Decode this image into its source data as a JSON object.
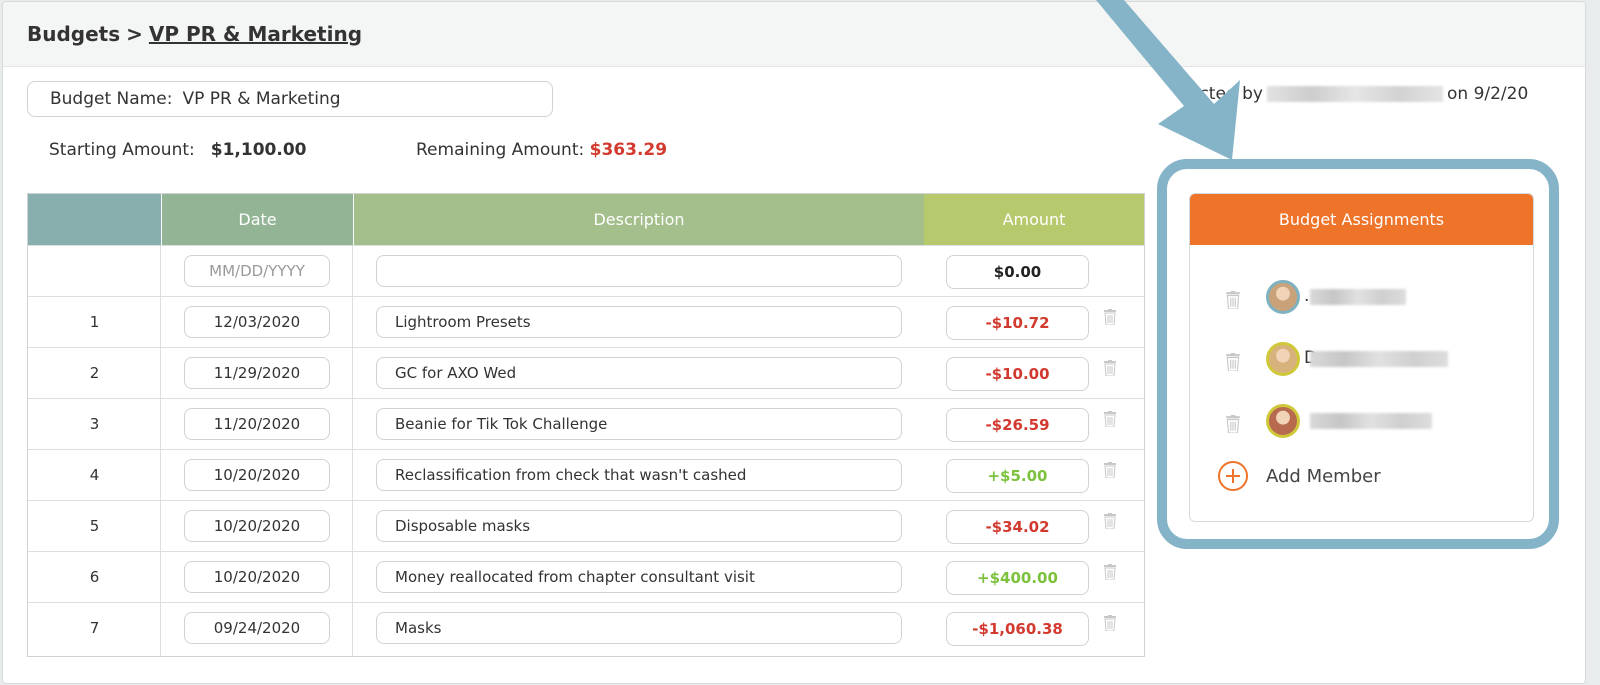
{
  "breadcrumb": {
    "root": "Budgets",
    "separator": ">",
    "current": "VP PR & Marketing"
  },
  "budget": {
    "name_label": "Budget Name:",
    "name_value": "VP PR & Marketing",
    "starting_label": "Starting Amount:",
    "starting_value": "$1,100.00",
    "remaining_label": "Remaining Amount:",
    "remaining_value": "$363.29",
    "created_prefix": "ected by",
    "created_suffix": "on 9/2/20"
  },
  "table": {
    "headers": [
      "",
      "Date",
      "Description",
      "Amount"
    ],
    "new_row": {
      "date_placeholder": "MM/DD/YYYY",
      "description": "",
      "amount": "$0.00"
    },
    "rows": [
      {
        "num": "1",
        "date": "12/03/2020",
        "description": "Lightroom Presets",
        "amount": "-$10.72",
        "sign": "neg"
      },
      {
        "num": "2",
        "date": "11/29/2020",
        "description": "GC for AXO Wed",
        "amount": "-$10.00",
        "sign": "neg"
      },
      {
        "num": "3",
        "date": "11/20/2020",
        "description": "Beanie for Tik Tok Challenge",
        "amount": "-$26.59",
        "sign": "neg"
      },
      {
        "num": "4",
        "date": "10/20/2020",
        "description": "Reclassification from check that wasn't cashed",
        "amount": "+$5.00",
        "sign": "pos"
      },
      {
        "num": "5",
        "date": "10/20/2020",
        "description": "Disposable masks",
        "amount": "-$34.02",
        "sign": "neg"
      },
      {
        "num": "6",
        "date": "10/20/2020",
        "description": "Money reallocated from chapter consultant visit",
        "amount": "+$400.00",
        "sign": "pos"
      },
      {
        "num": "7",
        "date": "09/24/2020",
        "description": "Masks",
        "amount": "-$1,060.38",
        "sign": "neg"
      }
    ]
  },
  "assignments": {
    "title": "Budget Assignments",
    "members": [
      {
        "initial": ".",
        "avatar_ring": "#7fb2c0",
        "avatar_fill": "#c9a27a"
      },
      {
        "initial": "D",
        "avatar_ring": "#cfc93a",
        "avatar_fill": "#d8b27c"
      },
      {
        "initial": "",
        "avatar_ring": "#cfc93a",
        "avatar_fill": "#b86a4f"
      }
    ],
    "add_label": "Add Member"
  },
  "colors": {
    "negative": "#d33a2f",
    "positive": "#7cc23c",
    "accent_orange": "#ee7429",
    "highlight_blue": "#85b4c8"
  },
  "icons": {
    "delete": "trash-icon",
    "add": "plus-circle-icon",
    "annotation": "arrow-annotation"
  }
}
